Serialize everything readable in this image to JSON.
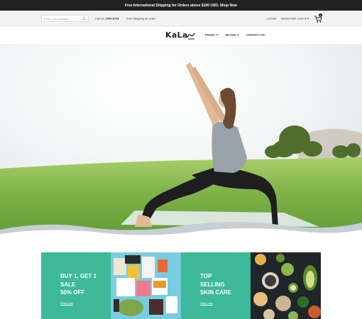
{
  "announcement": "Free International Shipping for Orders above $100 USD. Shop Now",
  "utility": {
    "search_placeholder": "Enter your keyword ...",
    "call_label": "Call us:",
    "call_number": "1900-6789",
    "shipping_note": "Free Shipping all order!",
    "login": "LOGIN",
    "register": "REGISTER",
    "currency": "USD $",
    "cart_count": "0"
  },
  "header": {
    "logo": "KaLa",
    "nav": [
      {
        "label": "PAGES",
        "has_dropdown": true
      },
      {
        "label": "BLOGS",
        "has_dropdown": true
      },
      {
        "label": "CONTACT US",
        "has_dropdown": false
      }
    ]
  },
  "promos": [
    {
      "lines": [
        "BUY 1, GET 1",
        "SALE",
        "50% OFF"
      ],
      "link": "Shop now"
    },
    {
      "lines": [
        "TOP",
        "SELLING",
        "SKIN CARE"
      ],
      "link": "Shop now"
    }
  ],
  "colors": {
    "accent": "#3db99a",
    "dark": "#222222",
    "grass": "#7fb64a"
  }
}
